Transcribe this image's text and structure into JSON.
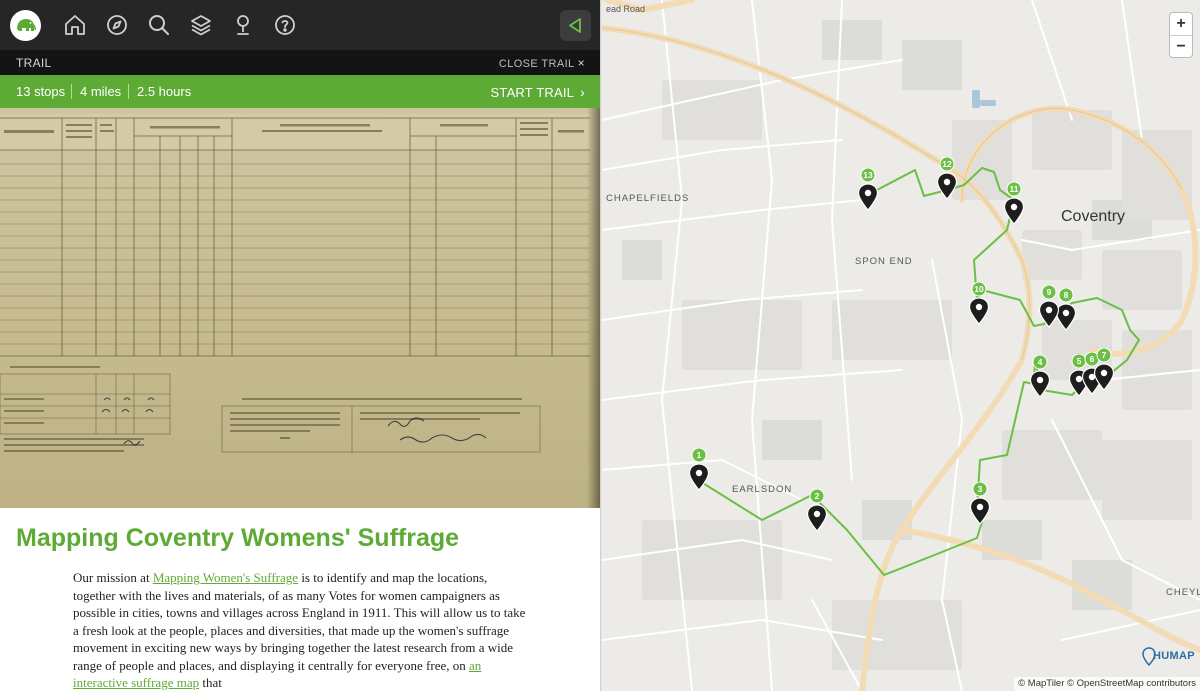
{
  "nav": {
    "icons": [
      "elephant-logo",
      "home-icon",
      "compass-icon",
      "search-icon",
      "layers-icon",
      "pin-icon",
      "help-icon",
      "collapse-left-icon"
    ]
  },
  "trail": {
    "label": "TRAIL",
    "close_label": "CLOSE TRAIL",
    "close_icon": "×",
    "stops": "13 stops",
    "distance": "4 miles",
    "duration": "2.5 hours",
    "start_label": "START TRAIL",
    "start_icon": "›"
  },
  "article": {
    "title": "Mapping Coventry Womens' Suffrage",
    "p1_before": "Our mission at ",
    "p1_link1": "Mapping Women's Suffrage",
    "p1_middle": " is to identify and map the locations, together with the lives and materials, of as many Votes for women campaigners as possible in cities, towns and villages across England in 1911. This will allow us to take a fresh look at the people, places and diversities, that made up the women's suffrage movement in exciting new ways by bringing together the latest research from a wide range of people and places, and displaying it centrally for everyone free, on ",
    "p1_link2": "an interactive suffrage map",
    "p1_after": " that"
  },
  "map": {
    "labels": {
      "road": "ead Road",
      "chapelfields": "CHAPELFIELDS",
      "spon_end": "SPON END",
      "coventry": "Coventry",
      "earlsdon": "EARLSDON",
      "cheylesmore": "CHEYLE"
    },
    "zoom_in": "+",
    "zoom_out": "−",
    "brand": "HUMAP",
    "attribution": "© MapTiler © OpenStreetMap contributors",
    "route_color": "#6cbf45",
    "marker_color": "#1e1e1e",
    "stops": [
      {
        "n": "1"
      },
      {
        "n": "2"
      },
      {
        "n": "3"
      },
      {
        "n": "4"
      },
      {
        "n": "5"
      },
      {
        "n": "6"
      },
      {
        "n": "7"
      },
      {
        "n": "8"
      },
      {
        "n": "9"
      },
      {
        "n": "10"
      },
      {
        "n": "11"
      },
      {
        "n": "12"
      },
      {
        "n": "13"
      }
    ]
  },
  "colors": {
    "accent": "#5dab35",
    "nav_bg": "#262626",
    "trail_bar_bg": "#141414"
  }
}
